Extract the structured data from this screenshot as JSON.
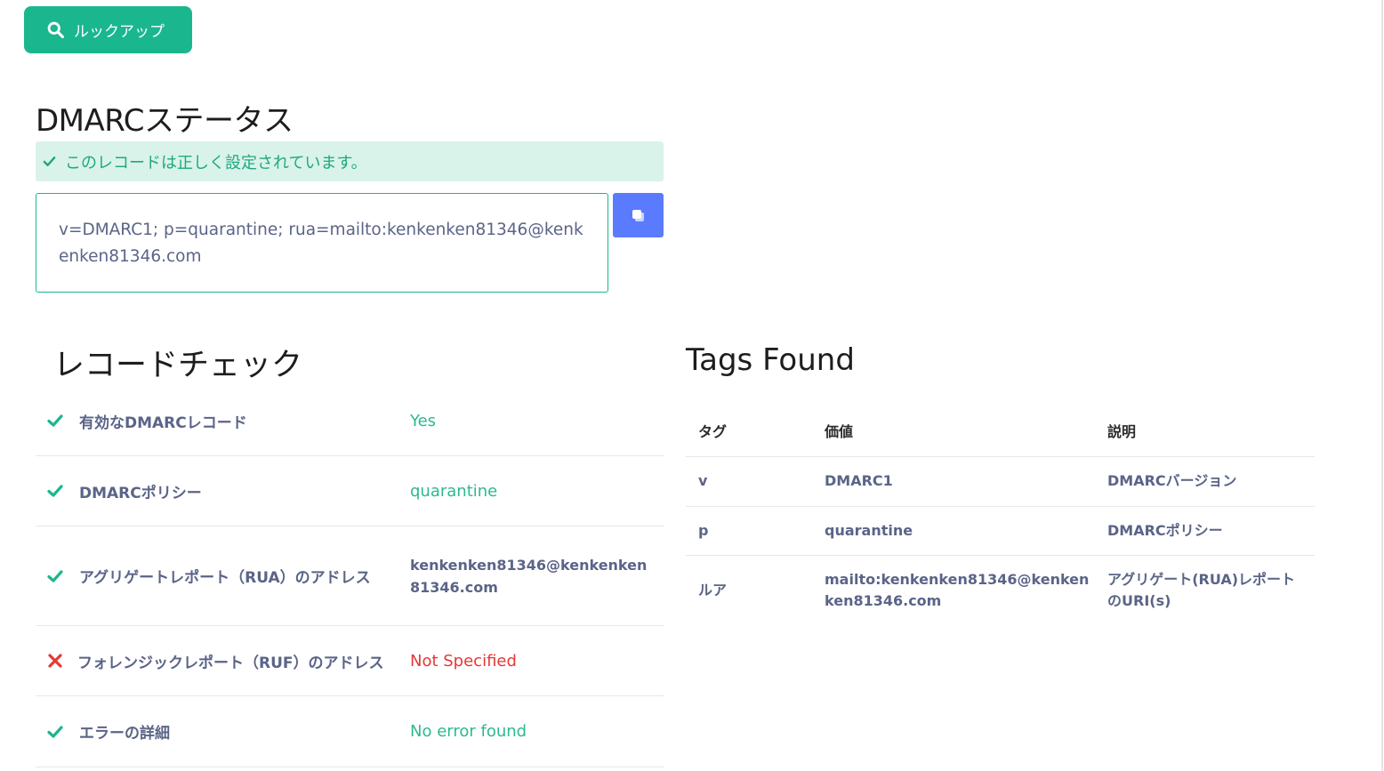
{
  "lookup_button": {
    "label": "ルックアップ",
    "icon": "search-icon"
  },
  "dmarc_status": {
    "title": "DMARCステータス",
    "alert": "このレコードは正しく設定されています。",
    "record": "v=DMARC1; p=quarantine; rua=mailto:kenkenken81346@kenkenken81346.com",
    "copy_icon": "copy-icon"
  },
  "record_check": {
    "title": "レコードチェック",
    "rows": [
      {
        "label": "有効なDMARCレコード",
        "value": "Yes",
        "status": "ok"
      },
      {
        "label": "DMARCポリシー",
        "value": "quarantine",
        "status": "ok"
      },
      {
        "label": "アグリゲートレポート（RUA）のアドレス",
        "value": "kenkenken81346@kenkenken81346.com",
        "status": "ok"
      },
      {
        "label": "フォレンジックレポート（RUF）のアドレス",
        "value": "Not Specified",
        "status": "error"
      },
      {
        "label": "エラーの詳細",
        "value": "No error found",
        "status": "ok"
      }
    ]
  },
  "tags_found": {
    "title": "Tags Found",
    "headers": {
      "tag": "タグ",
      "value": "価値",
      "description": "説明"
    },
    "rows": [
      {
        "tag": "v",
        "value": "DMARC1",
        "description": "DMARCバージョン"
      },
      {
        "tag": "p",
        "value": "quarantine",
        "description": "DMARCポリシー"
      },
      {
        "tag": "ルア",
        "value": "mailto:kenkenken81346@kenkenken81346.com",
        "description": "アグリゲート(RUA)レポートのURI(s)"
      }
    ]
  },
  "colors": {
    "accent": "#1ab78f",
    "ok": "#2cb98f",
    "error": "#e53935",
    "copy_button": "#5b7bfe",
    "text_muted": "#5b6488"
  }
}
